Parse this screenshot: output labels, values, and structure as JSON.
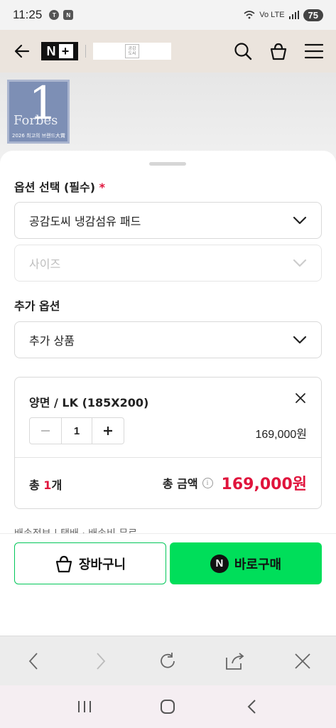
{
  "status_bar": {
    "time": "11:25",
    "battery": "75",
    "network": "Vo LTE"
  },
  "header": {
    "logo_text": "N",
    "store_logo_text": "공감\n도씨"
  },
  "background": {
    "badge_brand": "Forbes",
    "badge_number": "1",
    "badge_caption": "2026 최고의 브랜드大賞"
  },
  "options": {
    "required_label": "옵션 선택 (필수)",
    "required_mark": "*",
    "product_select_value": "공감도씨 냉감섬유 패드",
    "size_select_placeholder": "사이즈",
    "extra_label": "추가 옵션",
    "extra_select_value": "추가 상품"
  },
  "selected_item": {
    "name": "양면 / LK (185X200)",
    "quantity": "1",
    "price": "169,000원",
    "total_count_prefix": "총 ",
    "total_count": "1",
    "total_count_suffix": "개",
    "total_amount_label": "총 금액",
    "info_glyph": "i",
    "total_amount": "169,000원"
  },
  "shipping_peek": "배송정보  |  택배 · 배송비 무료",
  "actions": {
    "cart_label": "장바구니",
    "buy_label": "바로구매",
    "npay_glyph": "N"
  },
  "colors": {
    "accent_red": "#e0143c",
    "naver_green": "#00de5a",
    "header_bg": "#ebe4dd"
  }
}
